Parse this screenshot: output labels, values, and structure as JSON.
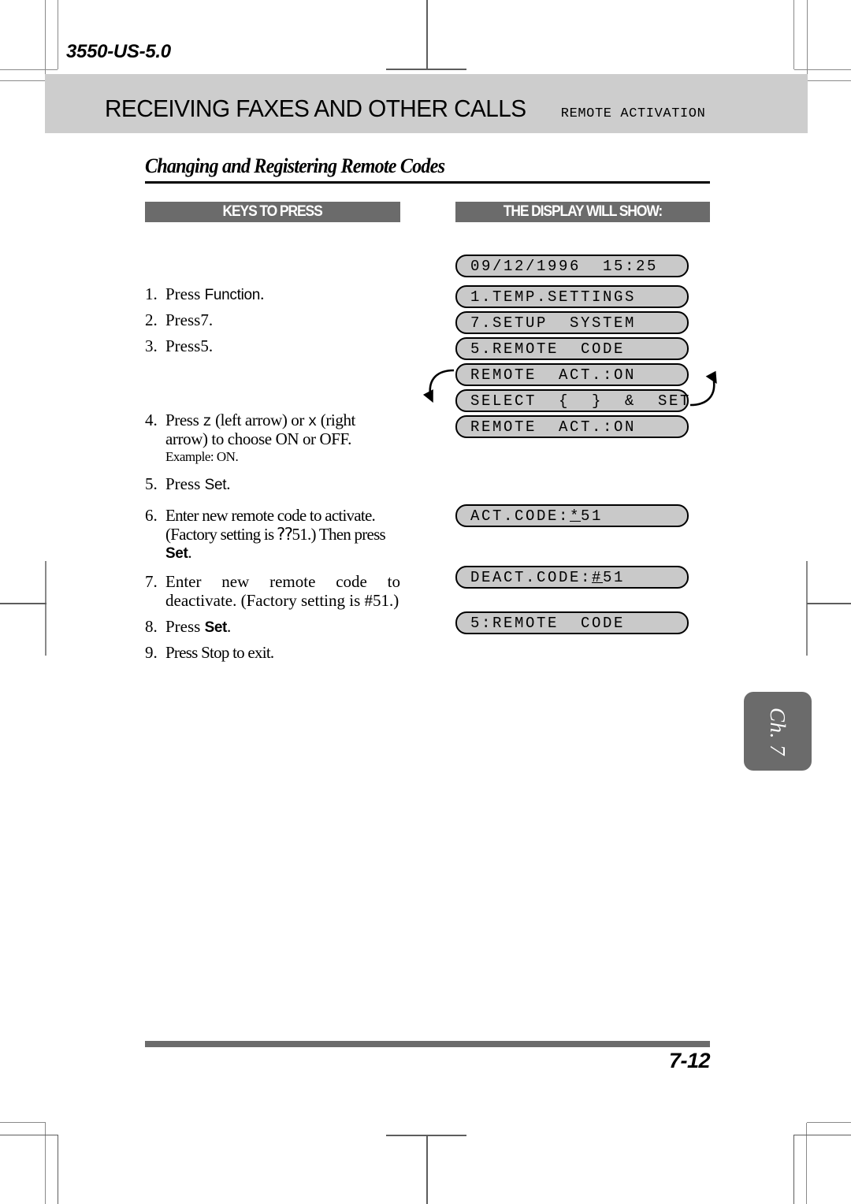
{
  "document": {
    "doc_number": "3550-US-5.0",
    "chapter_title": "RECEIVING FAXES AND OTHER CALLS",
    "section_title": "REMOTE ACTIVATION",
    "subheading": "Changing and Registering Remote Codes",
    "chapter_tab": "Ch. 7",
    "page_number": "7-12"
  },
  "columns": {
    "keys_header": "KEYS TO PRESS",
    "display_header": "THE DISPLAY WILL SHOW:"
  },
  "steps": [
    {
      "num": "1.",
      "text": "Press",
      "key": "Function",
      "suffix": "."
    },
    {
      "num": "2.",
      "text": "Press",
      "key": "7",
      "suffix": "."
    },
    {
      "num": "3.",
      "text": "Press",
      "key": "5",
      "suffix": "."
    },
    {
      "num": "4.",
      "line1_pre": "Press ",
      "arrow_left_key": "z",
      "line1_mid": " (left arrow) or ",
      "arrow_right_key": "x",
      "line1_post": " (right arrow) to choose ON or OFF.",
      "example": "Example: ON."
    },
    {
      "num": "5.",
      "text": "Press",
      "key": "Set",
      "suffix": "."
    },
    {
      "num": "6.",
      "text": "Enter new remote code to activate. (Factory setting is ⁇51.) Then press ",
      "key": "Set",
      "suffix": "."
    },
    {
      "num": "7.",
      "text": "Enter new remote code to deactivate. (Factory setting is #51.)"
    },
    {
      "num": "8.",
      "text": "Press ",
      "key": "Set",
      "suffix": "."
    },
    {
      "num": "9.",
      "text": "Press Stop to exit."
    }
  ],
  "displays": [
    {
      "id": "datetime",
      "text": "09/12/1996  15:25"
    },
    {
      "id": "temp-settings",
      "text": "1.TEMP.SETTINGS"
    },
    {
      "id": "setup-system",
      "text": "7.SETUP  SYSTEM"
    },
    {
      "id": "remote-code",
      "text": "5.REMOTE  CODE"
    },
    {
      "id": "remote-act-1",
      "text": "REMOTE  ACT.:ON"
    },
    {
      "id": "select-set",
      "text": "SELECT  {  }  &  SET"
    },
    {
      "id": "remote-act-2",
      "text": "REMOTE  ACT.:ON"
    },
    {
      "id": "act-code",
      "pre": "ACT.CODE:",
      "cursor": "*",
      "post": "51"
    },
    {
      "id": "deact-code",
      "pre": "DEACT.CODE:",
      "cursor": "#",
      "post": "51"
    },
    {
      "id": "remote-code-2",
      "text": "5:REMOTE  CODE"
    }
  ],
  "colors": {
    "band_gray": "#cdcdcd",
    "header_dark": "#6b6b6b",
    "lcd_fill": "#c9c9c9",
    "rule_black": "#000000"
  }
}
